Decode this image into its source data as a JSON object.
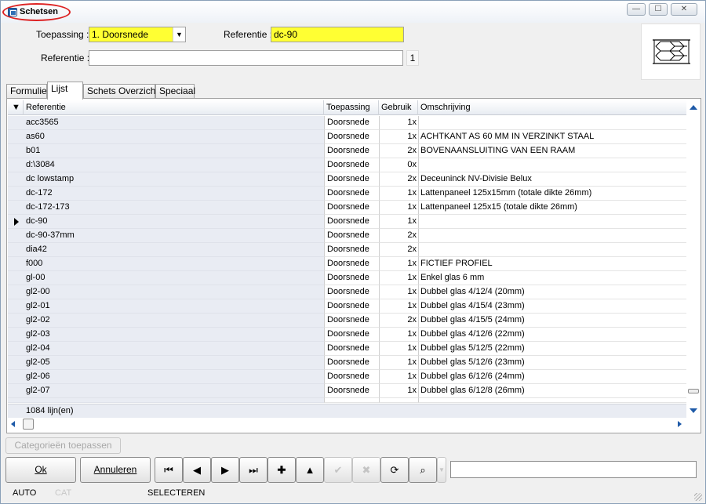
{
  "window": {
    "title": "Schetsen",
    "controls": {
      "minimize": "—",
      "maximize": "☐",
      "close": "✕"
    }
  },
  "form": {
    "toepassing_label": "Toepassing :",
    "toepassing_value": "1.  Doorsnede",
    "referentie_label": "Referentie :",
    "referentie_value": "dc-90",
    "referentie2_label": "Referentie :",
    "referentie2_value": "",
    "counter": "1"
  },
  "tabs": [
    {
      "label": "Formulier"
    },
    {
      "label": "Lijst"
    },
    {
      "label": "Schets Overzicht"
    },
    {
      "label": "Speciaal"
    }
  ],
  "grid": {
    "sort_icon": "sort-down-icon",
    "columns": [
      "Referentie",
      "Toepassing",
      "Gebruik",
      "Omschrijving"
    ],
    "current_row_index": 7,
    "rows": [
      [
        "acc3565",
        "Doorsnede",
        "1x",
        ""
      ],
      [
        "as60",
        "Doorsnede",
        "1x",
        "ACHTKANT AS 60 MM IN VERZINKT STAAL"
      ],
      [
        "b01",
        "Doorsnede",
        "2x",
        "BOVENAANSLUITING VAN EEN RAAM"
      ],
      [
        "d:\\3084",
        "Doorsnede",
        "0x",
        ""
      ],
      [
        "dc lowstamp",
        "Doorsnede",
        "2x",
        "Deceuninck NV-Divisie Belux"
      ],
      [
        "dc-172",
        "Doorsnede",
        "1x",
        "Lattenpaneel 125x15mm (totale dikte 26mm)"
      ],
      [
        "dc-172-173",
        "Doorsnede",
        "1x",
        "Lattenpaneel 125x15 (totale dikte 26mm)"
      ],
      [
        "dc-90",
        "Doorsnede",
        "1x",
        ""
      ],
      [
        "dc-90-37mm",
        "Doorsnede",
        "2x",
        ""
      ],
      [
        "dia42",
        "Doorsnede",
        "2x",
        ""
      ],
      [
        "f000",
        "Doorsnede",
        "1x",
        "FICTIEF PROFIEL"
      ],
      [
        "gl-00",
        "Doorsnede",
        "1x",
        "Enkel glas 6 mm"
      ],
      [
        "gl2-00",
        "Doorsnede",
        "1x",
        "Dubbel glas 4/12/4 (20mm)"
      ],
      [
        "gl2-01",
        "Doorsnede",
        "1x",
        "Dubbel glas 4/15/4 (23mm)"
      ],
      [
        "gl2-02",
        "Doorsnede",
        "2x",
        "Dubbel glas 4/15/5 (24mm)"
      ],
      [
        "gl2-03",
        "Doorsnede",
        "1x",
        "Dubbel glas 4/12/6 (22mm)"
      ],
      [
        "gl2-04",
        "Doorsnede",
        "1x",
        "Dubbel glas 5/12/5 (22mm)"
      ],
      [
        "gl2-05",
        "Doorsnede",
        "1x",
        "Dubbel glas 5/12/6 (23mm)"
      ],
      [
        "gl2-06",
        "Doorsnede",
        "1x",
        "Dubbel glas 6/12/6 (24mm)"
      ],
      [
        "gl2-07",
        "Doorsnede",
        "1x",
        "Dubbel glas 6/12/8 (26mm)"
      ]
    ],
    "footer": "1084 lijn(en)"
  },
  "bottom": {
    "categorieen_label": "Categorieën toepassen",
    "ok_label": "Ok",
    "annuleren_label": "Annuleren",
    "nav_icons": [
      "first-record-icon",
      "prev-record-icon",
      "next-record-icon",
      "last-record-icon",
      "add-record-icon",
      "edit-record-icon",
      "confirm-icon",
      "cancel-icon",
      "refresh-icon",
      "find-icon"
    ]
  },
  "status": {
    "mode": "AUTO",
    "cat": "CAT",
    "action": "SELECTEREN"
  },
  "colors": {
    "highlight_field": "#ffff33",
    "title_oval": "#dd2222",
    "scroll_arrow": "#1e5aa8"
  }
}
